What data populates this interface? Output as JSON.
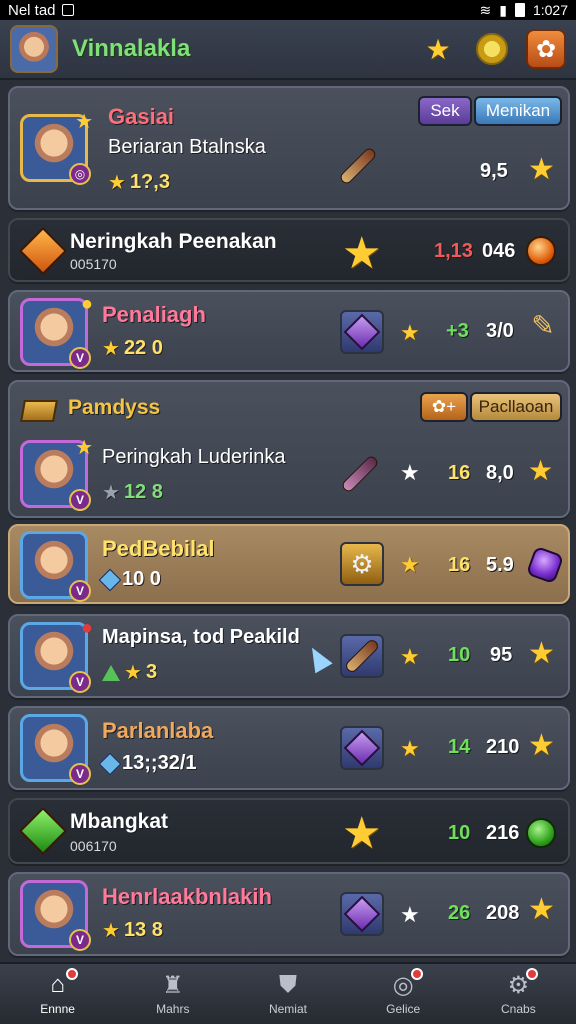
{
  "status_bar": {
    "carrier": "Nel tad",
    "time": "1:027"
  },
  "header": {
    "title": "Vinnalakla"
  },
  "colors": {
    "accent_green": "#7fe07a",
    "bg": "#2b3038",
    "gold": "#f5c443"
  },
  "cards": [
    {
      "name": "Gasiai",
      "subtitle": "Beriaran Btalnska",
      "rank": "1?,3",
      "button_a": "Sek",
      "button_b": "Menikan",
      "value": "9,5"
    },
    {
      "title": "Neringkah Peenakan",
      "small": "005170",
      "value_a": "1,13",
      "value_b": "046"
    },
    {
      "name": "Penaliagh",
      "rank": "22 0",
      "value_a": "+3",
      "value_b": "3/0"
    },
    {
      "name": "Pamdyss",
      "button_b": "Pacllaoan",
      "subtitle": "Peringkah Luderinka",
      "rank": "12 8",
      "value_a": "16",
      "value_b": "8,0"
    },
    {
      "name": "PedBebilal",
      "rank": "10 0",
      "value_a": "16",
      "value_b": "5.9"
    },
    {
      "name": "Mapinsa, tod Peakild",
      "rank": "3",
      "value_a": "10",
      "value_b": "95"
    },
    {
      "name": "Parlanlaba",
      "rank": "13;;32/1",
      "value_a": "14",
      "value_b": "210"
    },
    {
      "title": "Mbangkat",
      "small": "006170",
      "value_a": "10",
      "value_b": "216"
    },
    {
      "name": "Henrlaakbnlakih",
      "rank": "13 8",
      "value_a": "26",
      "value_b": "208"
    }
  ],
  "bottom_nav": [
    {
      "label": "Ennne",
      "icon": "home-icon",
      "active": true
    },
    {
      "label": "Mahrs",
      "icon": "castle-icon",
      "active": false
    },
    {
      "label": "Nemiat",
      "icon": "shield-icon",
      "active": false
    },
    {
      "label": "Gelice",
      "icon": "target-icon",
      "active": false
    },
    {
      "label": "Cnabs",
      "icon": "gear-icon",
      "active": false
    }
  ]
}
